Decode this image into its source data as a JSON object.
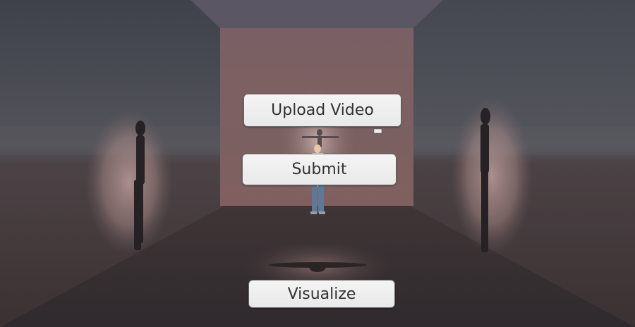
{
  "ui": {
    "upload_label": "Upload Video",
    "submit_label": "Submit",
    "visualize_label": "Visualize"
  },
  "colors": {
    "ceiling": "#5a5562",
    "left_wall": "#4a4c52",
    "right_wall": "#4b4d53",
    "back_wall": "#7d6264",
    "floor": "#3c3436",
    "spotlight": "#c7a8a6",
    "button_bg": "#f1f1f1",
    "button_text": "#323232"
  }
}
